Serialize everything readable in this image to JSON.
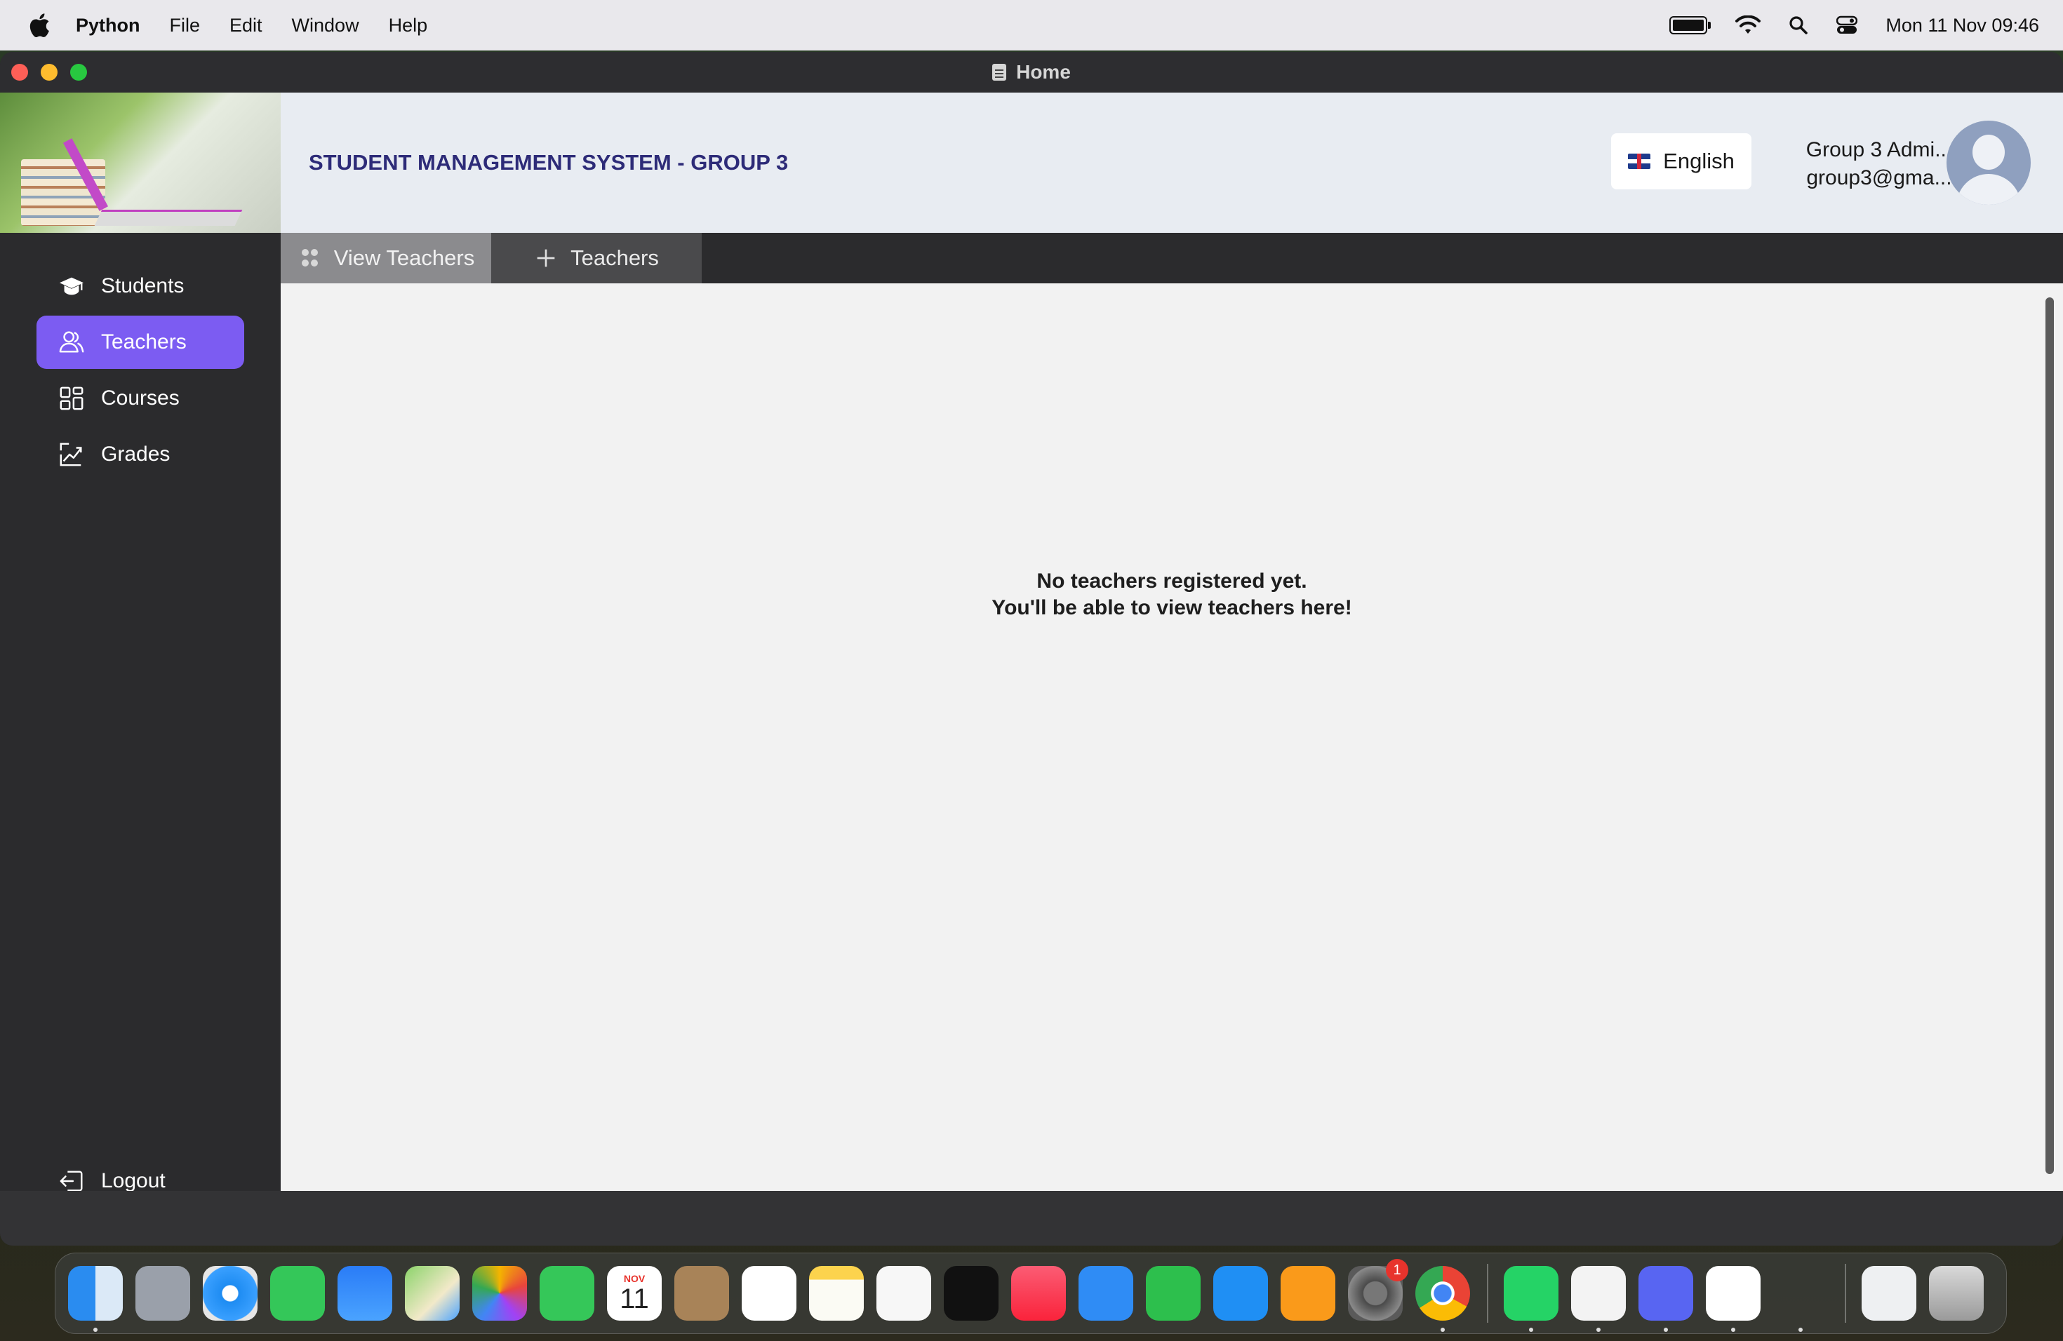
{
  "menubar": {
    "app_name": "Python",
    "items": [
      "File",
      "Edit",
      "Window",
      "Help"
    ],
    "clock": "Mon 11 Nov  09:46"
  },
  "window": {
    "title": "Home"
  },
  "header": {
    "title": "STUDENT MANAGEMENT SYSTEM - GROUP 3",
    "language": "English",
    "user_name": "Group 3 Admi...",
    "user_email": "group3@gma..."
  },
  "sidebar": {
    "items": [
      {
        "label": "Students",
        "icon": "graduation-cap-icon",
        "active": false
      },
      {
        "label": "Teachers",
        "icon": "people-icon",
        "active": true
      },
      {
        "label": "Courses",
        "icon": "grid-icon",
        "active": false
      },
      {
        "label": "Grades",
        "icon": "chart-icon",
        "active": false
      }
    ],
    "logout": "Logout"
  },
  "tabs": [
    {
      "label": "View Teachers",
      "icon": "people-icon",
      "selected": true
    },
    {
      "label": "Teachers",
      "icon": "plus-icon",
      "selected": false
    }
  ],
  "main": {
    "empty_line1": "No teachers registered yet.",
    "empty_line2": "You'll be able to view teachers here!"
  },
  "dock": {
    "calendar_month": "NOV",
    "calendar_day": "11",
    "settings_badge": "1",
    "apps": [
      "finder",
      "launchpad",
      "safari",
      "messages",
      "mail",
      "maps",
      "photos",
      "facetime",
      "calendar",
      "contacts",
      "reminders",
      "notes",
      "freeform",
      "apple-tv",
      "music",
      "keynote",
      "numbers",
      "app-store",
      "pages",
      "system-settings",
      "chrome",
      "whatsapp",
      "vscode",
      "discord",
      "powerpoint",
      "python-launcher",
      "document",
      "trash"
    ]
  },
  "colors": {
    "accent": "#7c5cf2",
    "title": "#2d2b78",
    "header_bg": "#e8ecf2",
    "sidebar_bg": "#2b2b2d",
    "content_bg": "#f2f2f2"
  }
}
